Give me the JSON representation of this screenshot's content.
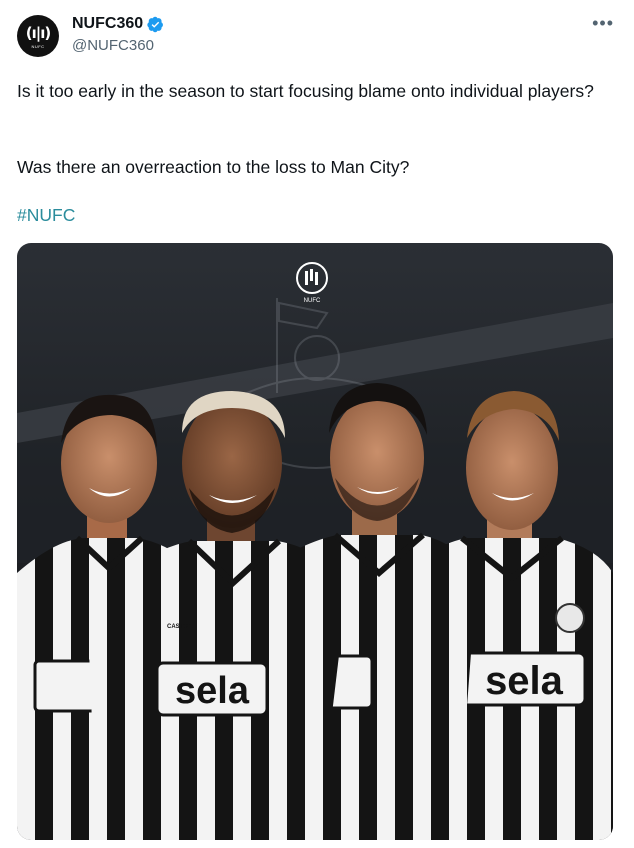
{
  "account": {
    "display_name": "NUFC360",
    "handle": "@NUFC360",
    "avatar_logo": "NUFC",
    "verified": true
  },
  "tweet": {
    "paragraph_1": "Is it too early in the season to start focusing blame onto individual players?",
    "paragraph_2": "Was there an overreaction to the loss to Man City?",
    "hashtag": "#NUFC"
  },
  "media": {
    "brand_mark": "NUFC",
    "sponsor": "sela",
    "kit_maker": "CASTORE"
  },
  "icons": {
    "more": "more-horizontal-icon",
    "verified": "verified-badge-icon"
  },
  "colors": {
    "verified_blue": "#1d9bf0",
    "hashtag": "#2a8c9c",
    "text": "#0f1419",
    "secondary": "#536471"
  }
}
